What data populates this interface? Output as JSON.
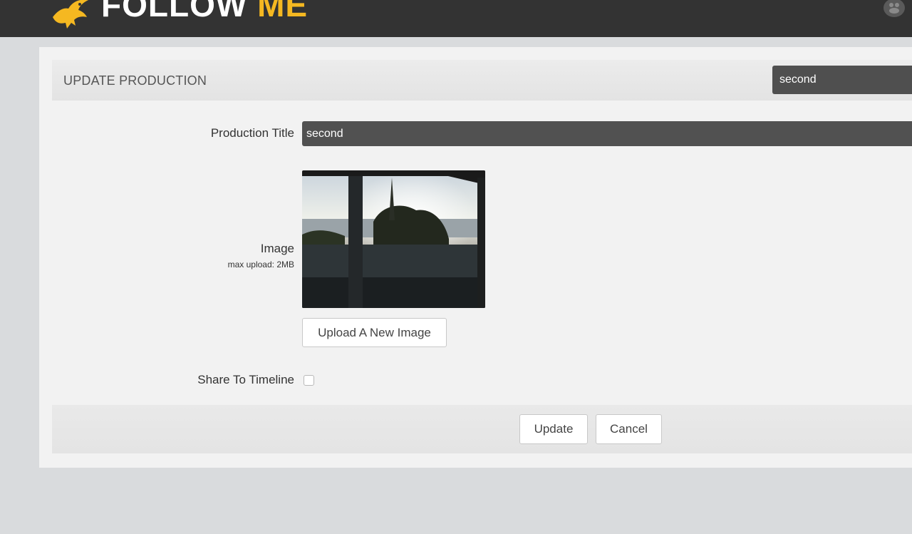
{
  "brand": {
    "name_part1": "FOLLOW",
    "name_part2": "ME",
    "logo_icon": "bird-logo-icon",
    "accent_color": "#f5b821"
  },
  "topbar": {
    "user_icon": "users-icon"
  },
  "panel": {
    "title": "UPDATE PRODUCTION",
    "selected_production": "second"
  },
  "form": {
    "production_title_label": "Production Title",
    "production_title_value": "second",
    "image_label": "Image",
    "image_sublabel": "max upload: 2MB",
    "upload_button": "Upload A New Image",
    "share_label": "Share To Timeline",
    "share_checked": false
  },
  "actions": {
    "update": "Update",
    "cancel": "Cancel"
  }
}
